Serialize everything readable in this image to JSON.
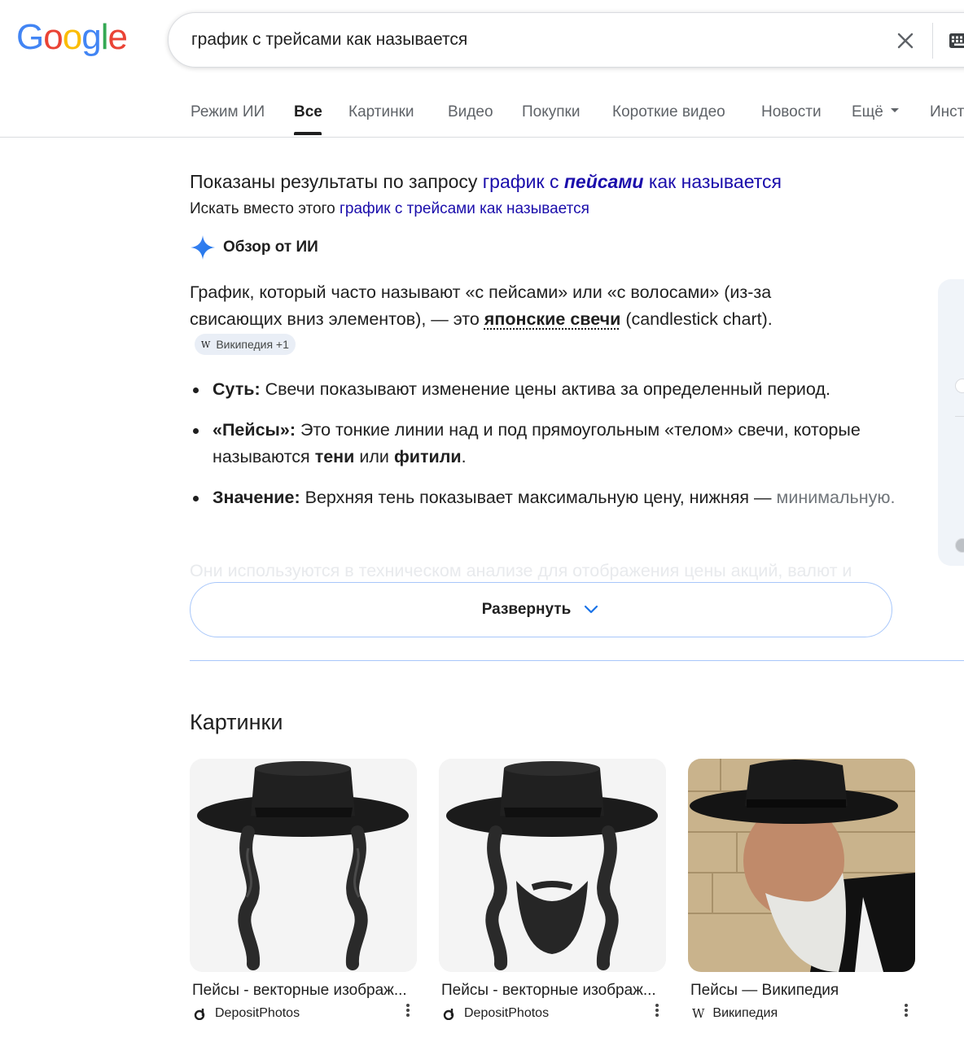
{
  "header": {
    "logo_letters": [
      {
        "char": "G",
        "color": "#4285F4"
      },
      {
        "char": "o",
        "color": "#EA4335"
      },
      {
        "char": "o",
        "color": "#FBBC05"
      },
      {
        "char": "g",
        "color": "#4285F4"
      },
      {
        "char": "l",
        "color": "#34A853"
      },
      {
        "char": "e",
        "color": "#EA4335"
      }
    ],
    "search_value": "график с трейсами как называется",
    "icons": [
      "clear-icon",
      "keyboard-icon"
    ]
  },
  "tabs": [
    {
      "label": "Режим ИИ",
      "active": false
    },
    {
      "label": "Все",
      "active": true
    },
    {
      "label": "Картинки",
      "active": false
    },
    {
      "label": "Видео",
      "active": false
    },
    {
      "label": "Покупки",
      "active": false
    },
    {
      "label": "Короткие видео",
      "active": false
    },
    {
      "label": "Новости",
      "active": false
    },
    {
      "label": "Ещё",
      "active": false
    },
    {
      "label": "Инст",
      "active": false
    }
  ],
  "spelling": {
    "shown_prefix": "Показаны результаты по запросу",
    "corrected_before": "график с",
    "corrected_bold": "пейсами",
    "corrected_after": "как называется",
    "instead_prefix": "Искать вместо этого",
    "original_query": "график с трейсами как называется"
  },
  "ai_overview": {
    "title": "Обзор от ИИ",
    "intro_before": "График, который часто называют «с пейсами» или «с волосами» (из-за свисающих вниз элементов), — это",
    "intro_bold": "японские свечи",
    "intro_after": "(candlestick chart).",
    "source_chip": "Википедия +1",
    "bullets": [
      {
        "bold": "Суть:",
        "text": "Свечи показывают изменение цены актива за определенный период."
      },
      {
        "bold": "«Пейсы»:",
        "text_1": "Это тонкие линии над и под прямоугольным «телом» свечи, которые называются",
        "bold_2": "тени",
        "text_2": "или",
        "bold_3": "фитили",
        "text_3": "."
      },
      {
        "bold": "Значение:",
        "text": "Верхняя тень показывает максимальную цену, нижняя —",
        "text_tail": "минимальную."
      }
    ],
    "faded_text": "Они используются в техническом анализе для отображения цены акций, валют и",
    "expand_label": "Развернуть",
    "accent_color": "#a8c7fa"
  },
  "images": {
    "title": "Картинки",
    "items": [
      {
        "caption": "Пейсы - векторные изображ...",
        "source": "DepositPhotos"
      },
      {
        "caption": "Пейсы - векторные изображ...",
        "source": "DepositPhotos"
      },
      {
        "caption": "Пейсы — Википедия",
        "source": "Википедия"
      }
    ]
  }
}
